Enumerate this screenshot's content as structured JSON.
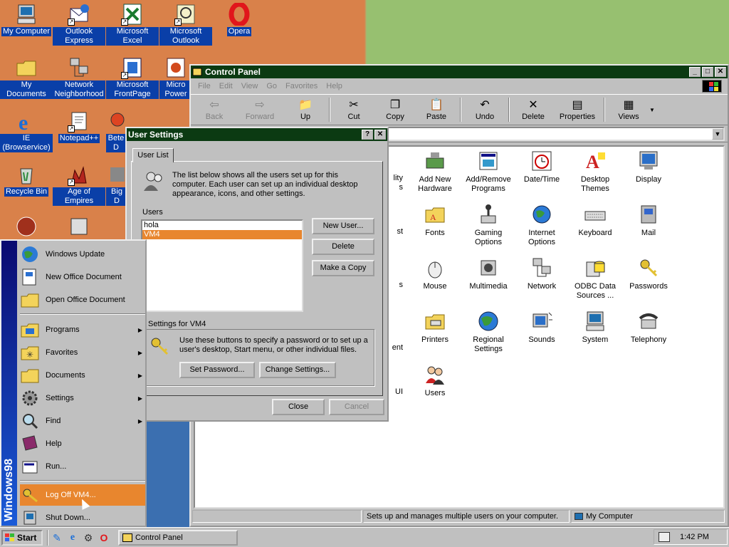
{
  "desktop": {
    "icons": [
      {
        "label": "My Computer"
      },
      {
        "label": "Outlook Express"
      },
      {
        "label": "Microsoft Excel"
      },
      {
        "label": "Microsoft Outlook"
      },
      {
        "label": "Opera"
      },
      {
        "label": "My Documents"
      },
      {
        "label": "Network Neighborhood"
      },
      {
        "label": "Microsoft FrontPage"
      },
      {
        "label": "Micro Power"
      },
      {
        "label": "IE (Browservice)"
      },
      {
        "label": "Notepad++"
      },
      {
        "label": "Bete D"
      },
      {
        "label": "Recycle Bin"
      },
      {
        "label": "Age of Empires"
      },
      {
        "label": "Big D"
      }
    ]
  },
  "control_panel": {
    "title": "Control Panel",
    "menu": [
      "File",
      "Edit",
      "View",
      "Go",
      "Favorites",
      "Help"
    ],
    "toolbar": {
      "back": "Back",
      "forward": "Forward",
      "up": "Up",
      "cut": "Cut",
      "copy": "Copy",
      "paste": "Paste",
      "undo": "Undo",
      "delete": "Delete",
      "properties": "Properties",
      "views": "Views"
    },
    "items": [
      "Add New Hardware",
      "Add/Remove Programs",
      "Date/Time",
      "Desktop Themes",
      "Display",
      "Fonts",
      "Gaming Options",
      "Internet Options",
      "Keyboard",
      "Mail",
      "Mouse",
      "Multimedia",
      "Network",
      "ODBC Data Sources ...",
      "Passwords",
      "Printers",
      "Regional Settings",
      "Sounds",
      "System",
      "Telephony",
      "Users"
    ],
    "partial_labels": [
      "lity",
      "s",
      "st",
      "s",
      "ent",
      "UI"
    ],
    "status_text": "Sets up and manages multiple users on your computer.",
    "status_location": "My Computer"
  },
  "user_settings": {
    "title": "User Settings",
    "help_btn": "?",
    "close_btn": "✕",
    "tab": "User List",
    "description": "The list below shows all the users set up for this computer. Each user can set up an individual desktop appearance, icons, and other settings.",
    "users_label": "Users",
    "users": [
      "hola",
      "VM4"
    ],
    "selected_user": "VM4",
    "new_user": "New User...",
    "delete": "Delete",
    "make_copy": "Make a Copy",
    "settings_for": "Settings for VM4",
    "settings_desc": "Use these buttons to specify a password or to set up a user's desktop, Start menu, or other individual files.",
    "set_password": "Set Password...",
    "change_settings": "Change Settings...",
    "close": "Close",
    "cancel": "Cancel"
  },
  "start_menu": {
    "brand": "Windows98",
    "items": {
      "windows_update": "Windows Update",
      "new_office": "New Office Document",
      "open_office": "Open Office Document",
      "programs": "Programs",
      "favorites": "Favorites",
      "documents": "Documents",
      "settings": "Settings",
      "find": "Find",
      "help": "Help",
      "run": "Run...",
      "log_off": "Log Off VM4...",
      "shut_down": "Shut Down..."
    }
  },
  "taskbar": {
    "start": "Start",
    "task": "Control Panel",
    "time": "1:42 PM"
  },
  "colors": {
    "titlebar": "#0b3a12",
    "highlight": "#e8862e",
    "face": "#c0c0c0"
  }
}
